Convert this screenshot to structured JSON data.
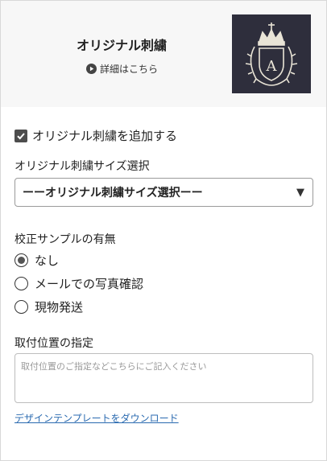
{
  "header": {
    "title": "オリジナル刺繍",
    "details_label": "詳細はこちら",
    "thumbnail_letter": "A",
    "thumbnail_icon": "crown-crest-icon"
  },
  "embroidery_checkbox": {
    "label": "オリジナル刺繍を追加する",
    "checked": true
  },
  "size_select": {
    "label": "オリジナル刺繍サイズ選択",
    "selected": "ーーオリジナル刺繍サイズ選択ーー"
  },
  "proof_sample": {
    "label": "校正サンプルの有無",
    "options": [
      {
        "label": "なし",
        "selected": true
      },
      {
        "label": "メールでの写真確認",
        "selected": false
      },
      {
        "label": "現物発送",
        "selected": false
      }
    ]
  },
  "position": {
    "label": "取付位置の指定",
    "placeholder": "取付位置のご指定などこちらにご記入ください",
    "value": ""
  },
  "download_link": "デザインテンプレートをダウンロード",
  "colors": {
    "header_bg": "#f7f7f7",
    "thumbnail_bg": "#2e2e3c",
    "link": "#2a6ab0",
    "checkbox": "#4d4d4d"
  }
}
